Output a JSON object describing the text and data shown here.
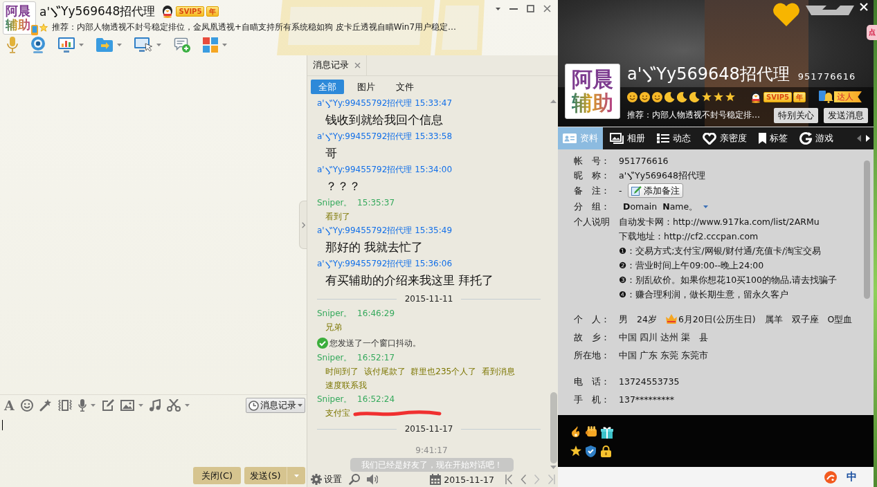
{
  "chat_window": {
    "contact": {
      "avatar_text": [
        "阿晨",
        "辅助"
      ],
      "mobile": true,
      "name": [
        "a'",
        "Yy569648招代理"
      ],
      "vip": "SVIP5",
      "vip_year": "年",
      "recommendation": "推荐：内部人物透视不封号稳定排位，金凤凰透视+自瞄支持所有系统稳如狗 皮卡丘透视自瞄Win7用户稳定…"
    },
    "font_button": "A",
    "history_button": "消息记录",
    "buttons": [
      {
        "kind": "plain",
        "label": "关闭(C)"
      },
      {
        "kind": "split",
        "label": "发送(S)"
      }
    ]
  },
  "history": {
    "tab": "消息记录",
    "filters": [
      {
        "label": "全部",
        "selected": true
      },
      {
        "label": "图片",
        "selected": false
      },
      {
        "label": "文件",
        "selected": false
      }
    ],
    "log": [
      {
        "kind": "message",
        "outgoing": false,
        "header": [
          "a'",
          "Yy:99455792招代理 15:33:47"
        ],
        "text": "钱收到就给我回个信息",
        "redacted": false
      },
      {
        "kind": "message",
        "outgoing": false,
        "header": [
          "a'",
          "Yy:99455792招代理 15:33:58"
        ],
        "text": "哥",
        "redacted": false
      },
      {
        "kind": "message",
        "outgoing": false,
        "header": [
          "a'",
          "Yy:99455792招代理 15:34:00"
        ],
        "text": "？？？",
        "redacted": false
      },
      {
        "kind": "message",
        "outgoing": true,
        "header": [
          "Sniper。  15:35:37"
        ],
        "text": "看到了",
        "redacted": false
      },
      {
        "kind": "message",
        "outgoing": false,
        "header": [
          "a'",
          "Yy:99455792招代理 15:35:49"
        ],
        "text": "那好的 我就去忙了",
        "redacted": false
      },
      {
        "kind": "message",
        "outgoing": false,
        "header": [
          "a'",
          "Yy:99455792招代理 15:36:06"
        ],
        "text": "有买辅助的介绍来我这里 拜托了",
        "redacted": false
      },
      {
        "kind": "date",
        "text": "2015-11-11"
      },
      {
        "kind": "message",
        "outgoing": true,
        "header": [
          "Sniper。  16:46:29"
        ],
        "text": "兄弟",
        "redacted": false
      },
      {
        "kind": "notice",
        "text": "您发送了一个窗口抖动。"
      },
      {
        "kind": "message",
        "outgoing": true,
        "header": [
          "Sniper。  16:52:17"
        ],
        "text": "时间到了  该付尾款了  群里也235个人了  看到消息速度联系我",
        "redacted": false
      },
      {
        "kind": "message",
        "outgoing": true,
        "header": [
          "Sniper。  16:52:24"
        ],
        "text": "支付宝",
        "redacted": true
      },
      {
        "kind": "date",
        "text": "2015-11-17"
      },
      {
        "kind": "time",
        "text": "9:41:17"
      },
      {
        "kind": "banner",
        "text": "我们已经是好友了，现在开始对话吧！"
      }
    ],
    "settings": "设置",
    "date": "2015-11-17"
  },
  "profile": {
    "avatar_text": [
      "阿晨",
      "辅助"
    ],
    "name": [
      "a'",
      "Yy569648招代理"
    ],
    "number": "951776616",
    "level_icons": [
      {
        "kind": "sun"
      },
      {
        "kind": "sun"
      },
      {
        "kind": "sun"
      },
      {
        "kind": "moon"
      },
      {
        "kind": "moon"
      },
      {
        "kind": "moon"
      },
      {
        "kind": "star"
      },
      {
        "kind": "star"
      },
      {
        "kind": "star"
      }
    ],
    "vip": "SVIP5",
    "vip_year": "年",
    "talent": "达人",
    "recommendation": "推荐：内部人物透视不封号稳定排…",
    "actions": [
      "特别关心",
      "发送消息"
    ],
    "tabs": [
      {
        "label": "资料",
        "selected": true
      },
      {
        "label": "相册",
        "selected": false
      },
      {
        "label": "动态",
        "selected": false
      },
      {
        "label": "亲密度",
        "selected": false
      },
      {
        "label": "标签",
        "selected": false
      },
      {
        "label": "游戏",
        "selected": false
      }
    ],
    "sections": [
      [
        {
          "kind": "text",
          "label": "帐　号：",
          "value": "951776616"
        },
        {
          "kind": "marked",
          "label": "昵　称：",
          "value": [
            "a'",
            "Yy569648招代理"
          ]
        },
        {
          "kind": "remark",
          "label": "备　注：",
          "value": "-",
          "button": "添加备注"
        },
        {
          "kind": "group",
          "label": "分　组：",
          "value": "**D**omain  **N**ame。"
        },
        {
          "kind": "lines",
          "label": "个人说明",
          "lines": [
            "自动发卡网：http://www.917ka.com/list/2ARMu",
            "下载地址：http://cf2.cccpan.com",
            "❶：交易方式;支付宝/网银/财付通/充值卡/淘宝交易",
            "❷：营业时间上午09:00--晚上24:00",
            "❸：别乱砍价。如果你想花10买100的物品,请去找骗子",
            "❹：赚合理利润，做长期生意，留永久客户"
          ]
        }
      ],
      [
        {
          "kind": "parts",
          "label": "个　人：",
          "parts": [
            {
              "text": "男",
              "crown": false
            },
            {
              "text": "24岁",
              "crown": false
            },
            {
              "text": "6月20日(公历生日)",
              "crown": true
            },
            {
              "text": "属羊",
              "crown": false
            },
            {
              "text": "双子座",
              "crown": false
            },
            {
              "text": "O型血",
              "crown": false
            }
          ]
        },
        {
          "kind": "text",
          "label": "故　乡：",
          "value": "中国 四川 达州 渠　县"
        },
        {
          "kind": "text",
          "label": "所在地：",
          "value": "中国 广东 东莞 东莞市"
        }
      ],
      [
        {
          "kind": "text",
          "label": "电　话：",
          "value": "13724553735"
        },
        {
          "kind": "text",
          "label": "手　机：",
          "value": "137*********"
        }
      ]
    ]
  },
  "desktop": {
    "tag": "点",
    "ime": "中"
  }
}
